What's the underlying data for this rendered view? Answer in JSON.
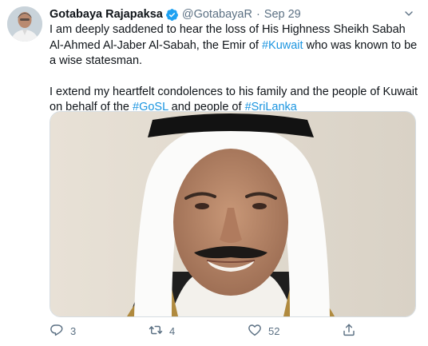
{
  "tweet": {
    "author": {
      "name": "Gotabaya Rajapaksa",
      "handle": "@GotabayaR",
      "verified": true,
      "avatar_icon": "profile-photo-avatar"
    },
    "separator": "·",
    "date": "Sep 29",
    "paragraph1": {
      "before": "I am deeply saddened to hear the loss of His Highness Sheikh Sabah Al-Ahmed Al-Jaber Al-Sabah, the Emir of ",
      "hashtag": "#Kuwait",
      "after": " who was known to be a wise statesman."
    },
    "paragraph2": {
      "before": "I extend my heartfelt condolences to his family and the people of Kuwait on behalf of the ",
      "hashtag1": "#GoSL",
      "middle": " and people of ",
      "hashtag2": "#SriLanka"
    },
    "media_image": "photo-of-man-in-white-keffiyeh",
    "actions": {
      "reply_count": "3",
      "retweet_count": "4",
      "like_count": "52"
    },
    "colors": {
      "link": "#1b95e0",
      "verified": "#1da1f2",
      "muted": "#5b7083"
    }
  }
}
